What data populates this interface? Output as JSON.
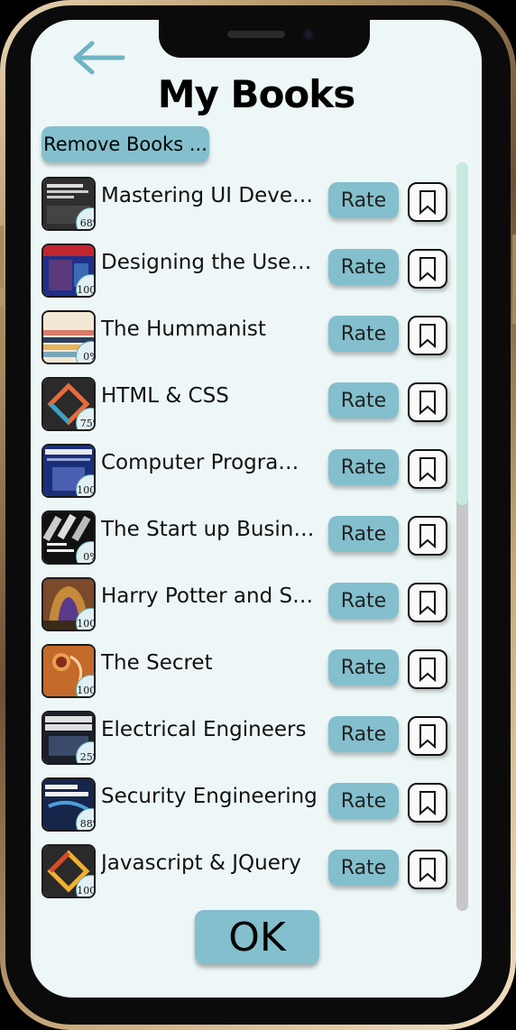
{
  "header": {
    "title": "My Books",
    "back_icon": "back-arrow-icon"
  },
  "actions": {
    "remove_label": "Remove Books ...",
    "ok_label": "OK"
  },
  "colors": {
    "accent": "#83bfcd",
    "screen_background": "#eef7f7",
    "scroll_thumb": "#c7eadf"
  },
  "books": [
    {
      "title": "Mastering UI Development",
      "progress": "68%",
      "rate_label": "Rate",
      "bookmark_icon": "bookmark-icon"
    },
    {
      "title": "Designing the User Inte...",
      "progress": "100%",
      "rate_label": "Rate",
      "bookmark_icon": "bookmark-icon"
    },
    {
      "title": "The Hummanist",
      "progress": "0%",
      "rate_label": "Rate",
      "bookmark_icon": "bookmark-icon"
    },
    {
      "title": "HTML & CSS",
      "progress": "75%",
      "rate_label": "Rate",
      "bookmark_icon": "bookmark-icon"
    },
    {
      "title": "Computer Programming",
      "progress": "100%",
      "rate_label": "Rate",
      "bookmark_icon": "bookmark-icon"
    },
    {
      "title": "The Start up Business",
      "progress": "0%",
      "rate_label": "Rate",
      "bookmark_icon": "bookmark-icon"
    },
    {
      "title": "Harry Potter and Sorcer...",
      "progress": "100%",
      "rate_label": "Rate",
      "bookmark_icon": "bookmark-icon"
    },
    {
      "title": "The Secret",
      "progress": "100%",
      "rate_label": "Rate",
      "bookmark_icon": "bookmark-icon"
    },
    {
      "title": "Electrical Engineers",
      "progress": "25%",
      "rate_label": "Rate",
      "bookmark_icon": "bookmark-icon"
    },
    {
      "title": "Security Engineering",
      "progress": "88%",
      "rate_label": "Rate",
      "bookmark_icon": "bookmark-icon"
    },
    {
      "title": "Javascript & JQuery",
      "progress": "100%",
      "rate_label": "Rate",
      "bookmark_icon": "bookmark-icon"
    }
  ]
}
